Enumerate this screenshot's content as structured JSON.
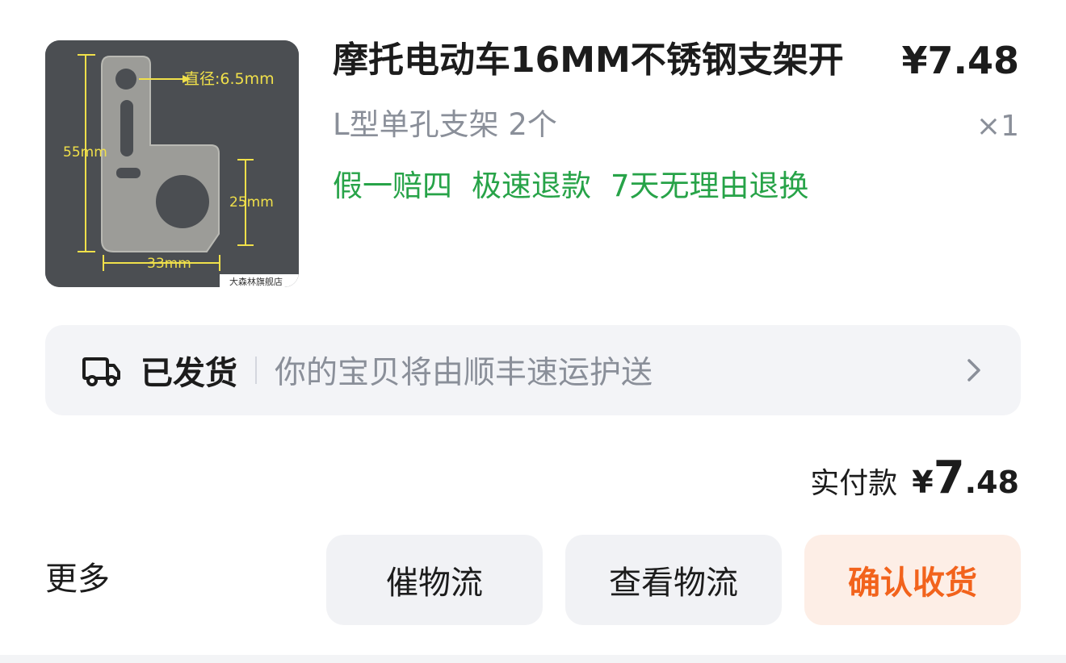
{
  "product": {
    "title": "摩托电动车16MM不锈钢支架开",
    "price": "¥7.48",
    "spec": "L型单孔支架 2个",
    "quantity": "×1",
    "tags": [
      "假一赔四",
      "极速退款",
      "7天无理由退换"
    ],
    "image": {
      "dimension_diameter": "直径:6.5mm",
      "dimension_height": "55mm",
      "dimension_hole": "25mm",
      "dimension_width": "33mm",
      "watermark": "大森林旗舰店"
    }
  },
  "shipping": {
    "icon": "truck-icon",
    "status": "已发货",
    "description": "你的宝贝将由顺丰速运护送"
  },
  "payment": {
    "label": "实付款",
    "currency": "¥",
    "amount_int": "7",
    "amount_dec": ".48"
  },
  "actions": {
    "more_label": "更多",
    "urge_label": "催物流",
    "track_label": "查看物流",
    "confirm_label": "确认收货"
  },
  "colors": {
    "tag_green": "#27a348",
    "confirm_orange": "#f2631c",
    "confirm_bg": "#fdeee6"
  }
}
